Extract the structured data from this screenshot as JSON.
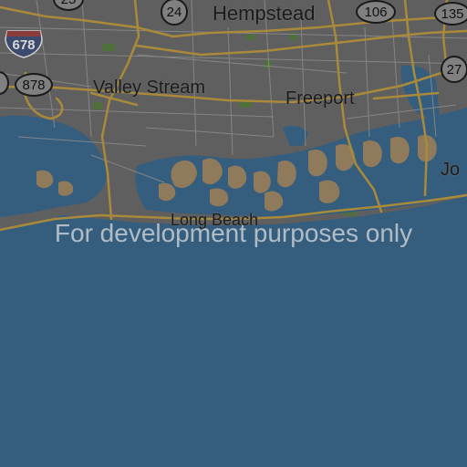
{
  "map": {
    "places": {
      "hempstead": "Hempstead",
      "valley_stream": "Valley Stream",
      "freeport": "Freeport",
      "long_beach": "Long Beach",
      "jones_partial": "Jo"
    },
    "shields": {
      "route_25": "25",
      "route_24": "24",
      "route_106": "106",
      "route_135": "135",
      "route_27": "27",
      "route_878": "878",
      "interstate_678": "678"
    },
    "watermark": "For development purposes only",
    "colors": {
      "land": "#5f5f5f",
      "water": "#355d7e",
      "highway": "#a88a3a",
      "local_road": "#8a8a8a",
      "marsh": "#8f7a5c",
      "park": "#4f6f3c"
    }
  }
}
